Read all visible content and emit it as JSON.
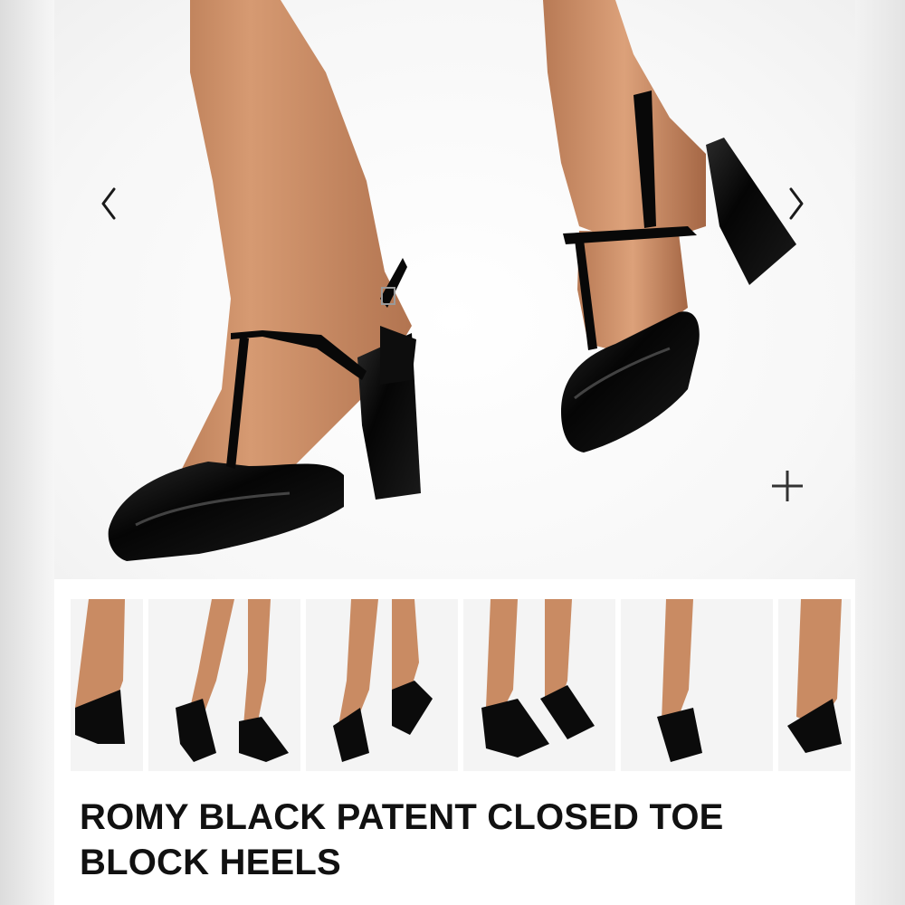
{
  "product": {
    "title": "ROMY BLACK PATENT CLOSED TOE BLOCK HEELS"
  },
  "gallery": {
    "prev_icon": "chevron-left-icon",
    "next_icon": "chevron-right-icon",
    "zoom_icon": "plus-icon",
    "thumbnail_count": 6
  },
  "colors": {
    "shoe": "#0b0b0b",
    "skin": "#c98b63",
    "background": "#ffffff",
    "text": "#111111"
  }
}
